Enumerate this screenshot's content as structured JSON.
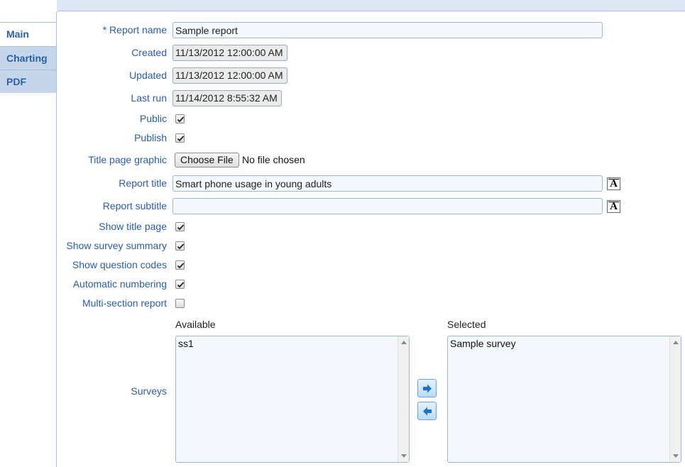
{
  "tabs": [
    {
      "label": "Main",
      "active": true
    },
    {
      "label": "Charting",
      "active": false
    },
    {
      "label": "PDF",
      "active": false
    }
  ],
  "form": {
    "report_name": {
      "label": "* Report name",
      "value": "Sample report"
    },
    "created": {
      "label": "Created",
      "value": "11/13/2012 12:00:00 AM"
    },
    "updated": {
      "label": "Updated",
      "value": "11/13/2012 12:00:00 AM"
    },
    "last_run": {
      "label": "Last run",
      "value": "11/14/2012 8:55:32 AM"
    },
    "public": {
      "label": "Public",
      "checked": true
    },
    "publish": {
      "label": "Publish",
      "checked": true
    },
    "title_page_graphic": {
      "label": "Title page graphic",
      "button": "Choose File",
      "status": "No file chosen"
    },
    "report_title": {
      "label": "Report title",
      "value": "Smart phone usage in young adults"
    },
    "report_subtitle": {
      "label": "Report subtitle",
      "value": ""
    },
    "show_title_page": {
      "label": "Show title page",
      "checked": true
    },
    "show_survey_summary": {
      "label": "Show survey summary",
      "checked": true
    },
    "show_question_codes": {
      "label": "Show question codes",
      "checked": true
    },
    "automatic_numbering": {
      "label": "Automatic numbering",
      "checked": true
    },
    "multi_section_report": {
      "label": "Multi-section report",
      "checked": false
    },
    "font_button_glyph": "A",
    "surveys": {
      "label": "Surveys",
      "available_header": "Available",
      "selected_header": "Selected",
      "available": [
        "ss1"
      ],
      "selected": [
        "Sample survey"
      ]
    }
  },
  "colors": {
    "label": "#2a5ea8",
    "tab_inactive": "#c5d5ea",
    "border": "#a9bfd6"
  }
}
